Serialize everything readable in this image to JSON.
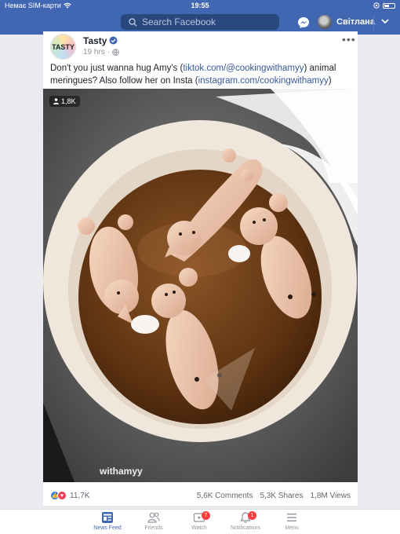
{
  "status_bar": {
    "carrier": "Немає SIM-карти",
    "time": "19:55"
  },
  "header": {
    "search_placeholder": "Search Facebook",
    "user_name": "Світлана"
  },
  "post": {
    "page_logo_text": "TASTY",
    "page_name": "Tasty",
    "time": "19 hrs",
    "text_part1": "Don't you just wanna hug Amy's (",
    "link1": "tiktok.com/@cookingwithamyy",
    "text_part2": ") animal meringues? Also follow her on Insta (",
    "link2": "instagram.com/cookingwithamyy",
    "text_part3": ")",
    "video_views": "1,8K",
    "video_watermark": "withamyy",
    "reactions_count": "11,7K",
    "comments": "5,6K Comments",
    "shares": "5,3K Shares",
    "views": "1,8M Views"
  },
  "tabbar": {
    "tabs": [
      {
        "label": "News Feed",
        "icon": "news-feed-icon",
        "active": true
      },
      {
        "label": "Friends",
        "icon": "friends-icon"
      },
      {
        "label": "Watch",
        "icon": "watch-icon",
        "badge": "7"
      },
      {
        "label": "Notifications",
        "icon": "bell-icon",
        "badge": "1"
      },
      {
        "label": "Menu",
        "icon": "menu-icon"
      }
    ]
  },
  "colors": {
    "brand_blue": "#4267b2",
    "link": "#365899",
    "badge_red": "#fa3e3e"
  }
}
